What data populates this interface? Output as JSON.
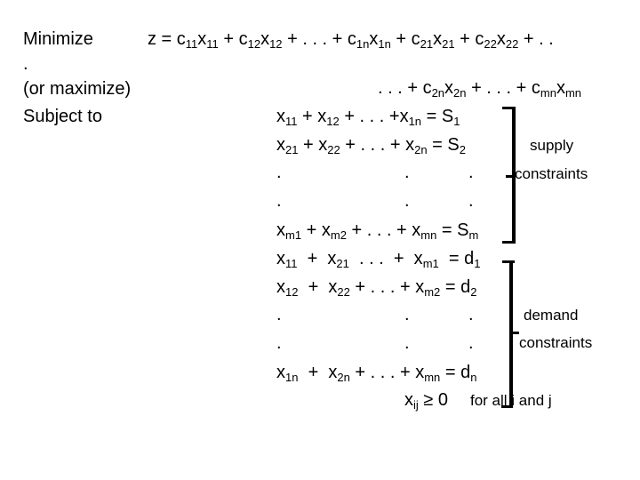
{
  "labels": {
    "minimize": "Minimize",
    "dot": ".",
    "or_maximize": "(or maximize)",
    "subject_to": "Subject to"
  },
  "objective": {
    "line1": [
      {
        "t": "z = c"
      },
      {
        "s": "11"
      },
      {
        "t": "x"
      },
      {
        "s": "11"
      },
      {
        "t": " + c"
      },
      {
        "s": "12"
      },
      {
        "t": "x"
      },
      {
        "s": "12"
      },
      {
        "t": " + . . . + c"
      },
      {
        "s": "1n"
      },
      {
        "t": "x"
      },
      {
        "s": "1n"
      },
      {
        "t": " + c"
      },
      {
        "s": "21"
      },
      {
        "t": "x"
      },
      {
        "s": "21"
      },
      {
        "t": " + c"
      },
      {
        "s": "22"
      },
      {
        "t": "x"
      },
      {
        "s": "22"
      },
      {
        "t": " + . ."
      }
    ],
    "line2": [
      {
        "t": ". . . + c"
      },
      {
        "s": "2n"
      },
      {
        "t": "x"
      },
      {
        "s": "2n"
      },
      {
        "t": " + . . . + c"
      },
      {
        "s": "mn"
      },
      {
        "t": "x"
      },
      {
        "s": "mn"
      }
    ]
  },
  "supply_constraints": [
    [
      {
        "t": "x"
      },
      {
        "s": "11"
      },
      {
        "t": " + x"
      },
      {
        "s": "12"
      },
      {
        "t": " + . . . +x"
      },
      {
        "s": "1n"
      },
      {
        "t": " = S"
      },
      {
        "s": "1"
      }
    ],
    [
      {
        "t": "x"
      },
      {
        "s": "21"
      },
      {
        "t": " + x"
      },
      {
        "s": "22"
      },
      {
        "t": " + . . . + x"
      },
      {
        "s": "2n"
      },
      {
        "t": " = S"
      },
      {
        "s": "2"
      }
    ],
    [
      {
        "t": ".                              .           ."
      }
    ],
    [
      {
        "t": ".                              .           ."
      }
    ],
    [
      {
        "t": "x"
      },
      {
        "s": "m1"
      },
      {
        "t": " + x"
      },
      {
        "s": "m2"
      },
      {
        "t": " + . . . + x"
      },
      {
        "s": "mn"
      },
      {
        "t": " = S"
      },
      {
        "s": "m"
      }
    ]
  ],
  "demand_constraints": [
    [
      {
        "t": "x"
      },
      {
        "s": "11"
      },
      {
        "t": "  +  x"
      },
      {
        "s": "21"
      },
      {
        "t": "  . . .  +  x"
      },
      {
        "s": "m1"
      },
      {
        "t": "  = d"
      },
      {
        "s": "1"
      }
    ],
    [
      {
        "t": "x"
      },
      {
        "s": "12"
      },
      {
        "t": "  +  x"
      },
      {
        "s": "22"
      },
      {
        "t": " + . . . + x"
      },
      {
        "s": "m2"
      },
      {
        "t": " = d"
      },
      {
        "s": "2"
      }
    ],
    [
      {
        "t": ".                              .           ."
      }
    ],
    [
      {
        "t": ".                              .           ."
      }
    ],
    [
      {
        "t": "x"
      },
      {
        "s": "1n"
      },
      {
        "t": "  +  x"
      },
      {
        "s": "2n"
      },
      {
        "t": " + . . . + x"
      },
      {
        "s": "mn"
      },
      {
        "t": " = d"
      },
      {
        "s": "n"
      }
    ]
  ],
  "nonnegativity": {
    "var": "x",
    "sub": "ij",
    "rel": " ≥ 0",
    "text": "for all i and j"
  },
  "annotations": {
    "supply_1": "supply",
    "supply_2": "constraints",
    "demand_1": "demand",
    "demand_2": "constraints"
  }
}
